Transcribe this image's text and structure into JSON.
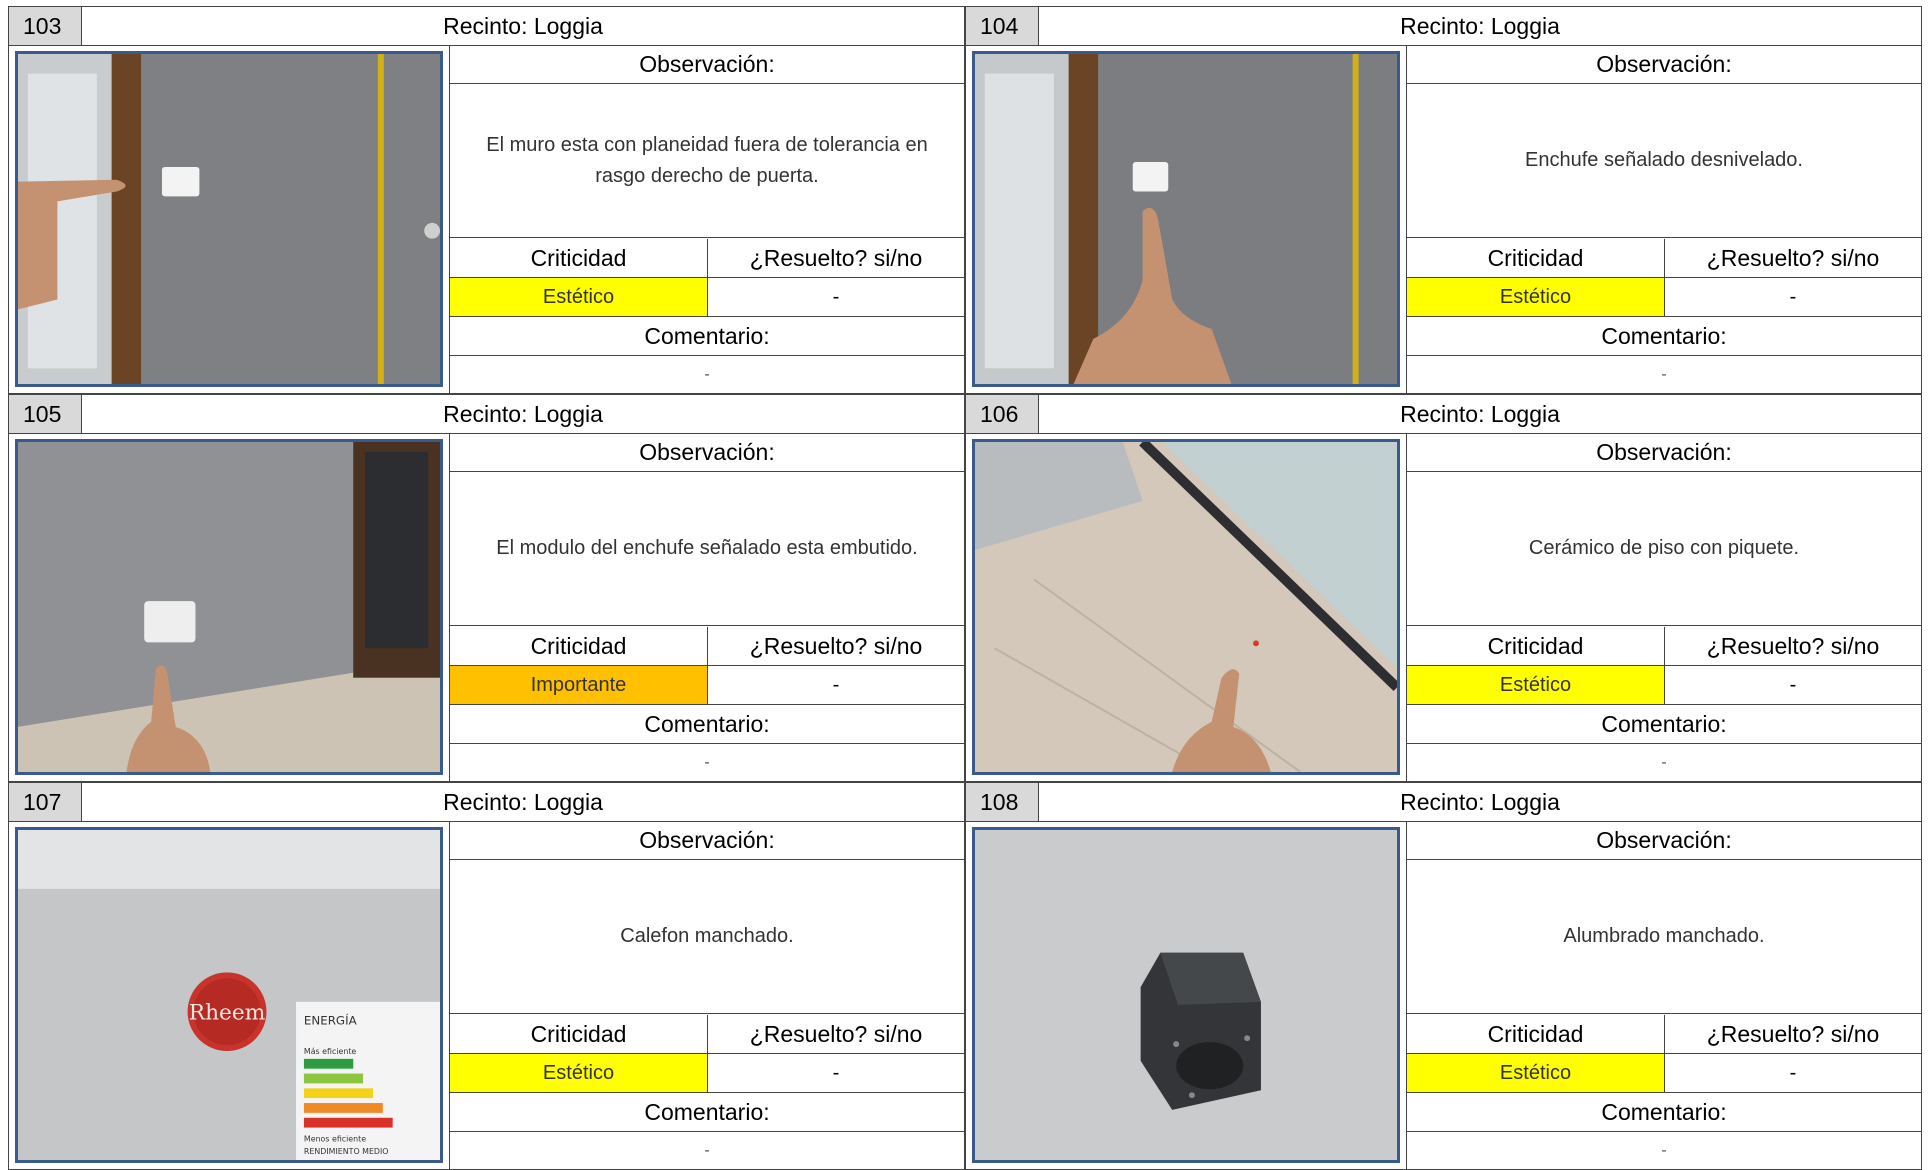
{
  "labels": {
    "recinto_prefix": "Recinto: ",
    "observacion": "Observación:",
    "criticidad": "Criticidad",
    "resuelto": "¿Resuelto? si/no",
    "comentario": "Comentario:"
  },
  "colors": {
    "estetico": "#ffff00",
    "importante": "#ffc000",
    "header_gray": "#d9d9d9",
    "photo_border": "#3a5a8c"
  },
  "items": [
    {
      "number": "103",
      "recinto": "Recinto: Loggia",
      "observacion": "El muro esta con planeidad fuera de tolerancia en rasgo derecho de puerta.",
      "criticidad": "Estético",
      "criticidad_color": "#ffff00",
      "resuelto": "-",
      "comentario": "-",
      "photo_icon": "wall-door-photo"
    },
    {
      "number": "104",
      "recinto": "Recinto: Loggia",
      "observacion": "Enchufe señalado desnivelado.",
      "criticidad": "Estético",
      "criticidad_color": "#ffff00",
      "resuelto": "-",
      "comentario": "-",
      "photo_icon": "outlet-wall-photo"
    },
    {
      "number": "105",
      "recinto": "Recinto: Loggia",
      "observacion": "El modulo del enchufe señalado esta embutido.",
      "criticidad": "Importante",
      "criticidad_color": "#ffc000",
      "resuelto": "-",
      "comentario": "-",
      "photo_icon": "outlet-low-photo"
    },
    {
      "number": "106",
      "recinto": "Recinto: Loggia",
      "observacion": "Cerámico de piso con piquete.",
      "criticidad": "Estético",
      "criticidad_color": "#ffff00",
      "resuelto": "-",
      "comentario": "-",
      "photo_icon": "floor-tile-photo"
    },
    {
      "number": "107",
      "recinto": "Recinto: Loggia",
      "observacion": "Calefon manchado.",
      "criticidad": "Estético",
      "criticidad_color": "#ffff00",
      "resuelto": "-",
      "comentario": "-",
      "photo_icon": "water-heater-photo",
      "photo_text": {
        "logo": "Rheem",
        "energia": "ENERGÍA",
        "mas": "Más eficiente",
        "menos": "Menos eficiente",
        "rend": "RENDIMIENTO MEDIO"
      }
    },
    {
      "number": "108",
      "recinto": "Recinto: Loggia",
      "observacion": "Alumbrado manchado.",
      "criticidad": "Estético",
      "criticidad_color": "#ffff00",
      "resuelto": "-",
      "comentario": "-",
      "photo_icon": "ceiling-light-photo"
    }
  ]
}
